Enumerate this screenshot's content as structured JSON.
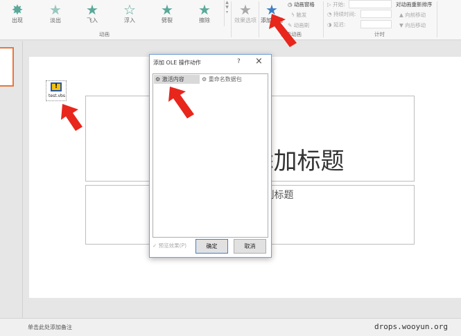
{
  "ribbon": {
    "animations": [
      {
        "label": "出现"
      },
      {
        "label": "淡出"
      },
      {
        "label": "飞入"
      },
      {
        "label": "浮入"
      },
      {
        "label": "劈裂"
      },
      {
        "label": "擦除"
      }
    ],
    "animation_group": "动画",
    "effect_options": "效果选项",
    "add_animation": "添加动画",
    "animation_pane": "动画窗格",
    "trigger": "触发",
    "animation_painter": "动画刷",
    "advanced_group": "高级动画",
    "start_label": "开始:",
    "duration_label": "持续时间:",
    "delay_label": "延迟:",
    "timing_group": "计时",
    "reorder_title": "对动画重新排序",
    "move_earlier": "向前移动",
    "move_later": "向后移动"
  },
  "slide": {
    "ole_label": "test.vbs",
    "title": "单击此处添加标题",
    "subtitle": "单击此处添加副标题"
  },
  "notes": "单击此处添加备注",
  "watermark": "drops.wooyun.org",
  "dialog": {
    "title": "添加 OLE 操作动作",
    "help": "?",
    "close": "×",
    "actions": [
      {
        "label": "激活内容"
      },
      {
        "label": "重命名数据包"
      }
    ],
    "preview": "预览效果(P)",
    "ok": "确定",
    "cancel": "取消"
  },
  "colors": {
    "accent": "#e8763a",
    "arrow": "#e8261c",
    "star": "#5aa99a"
  }
}
